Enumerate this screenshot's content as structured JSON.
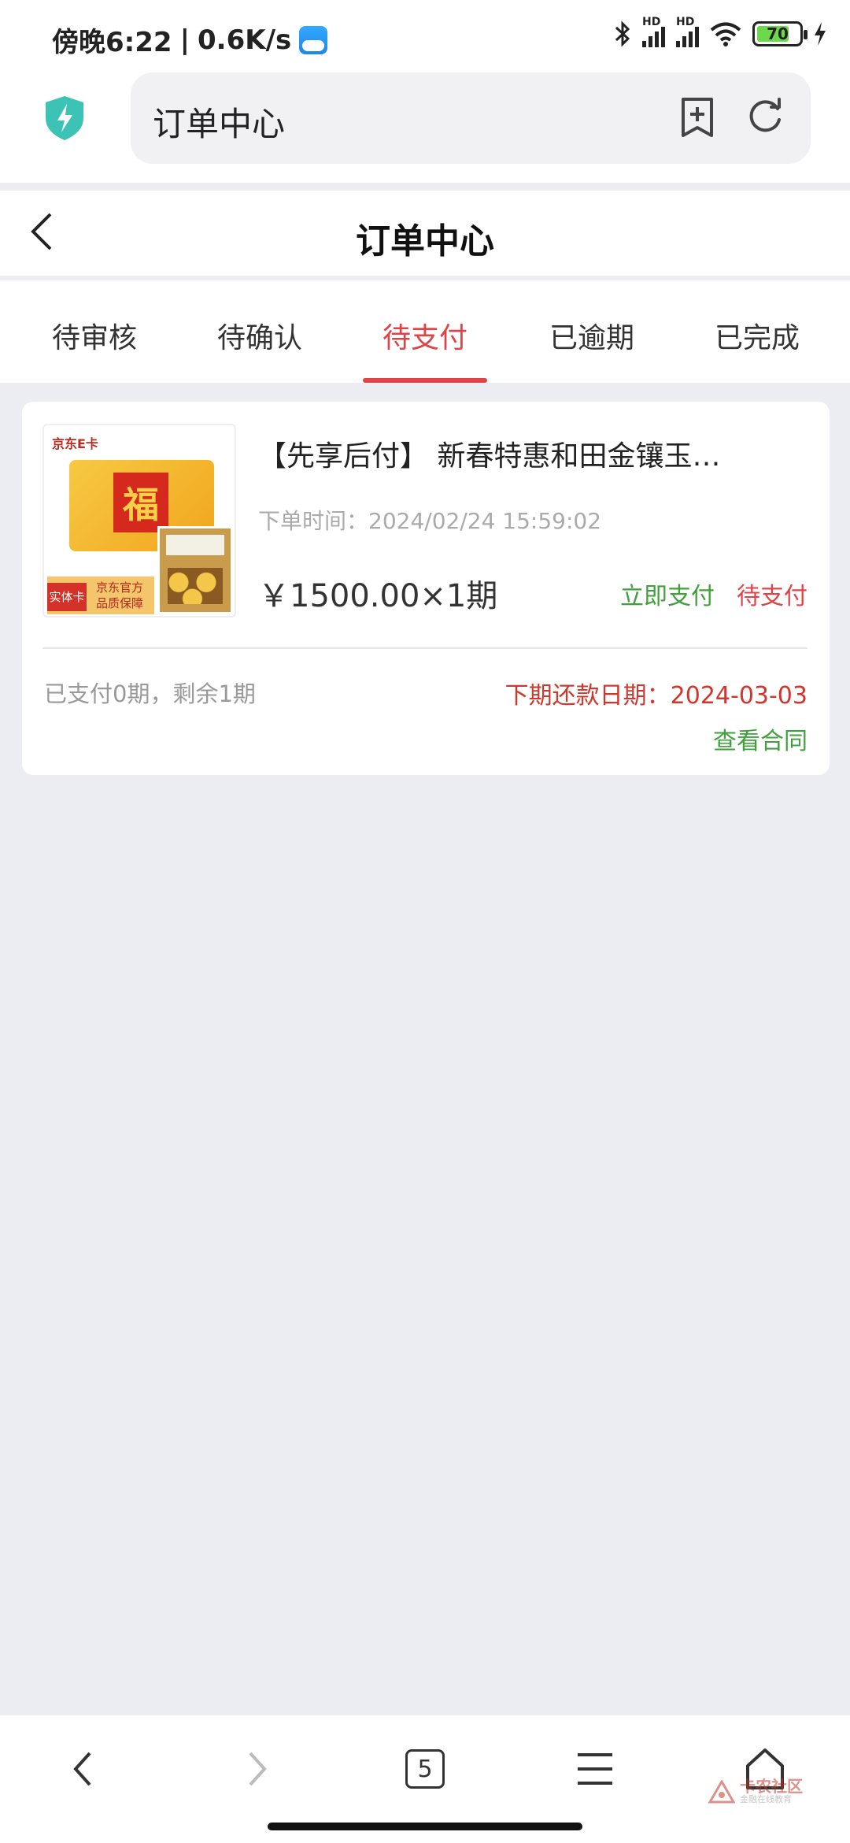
{
  "status_bar": {
    "time": "傍晚6:22",
    "speed": "0.6K/s",
    "network1": "HD",
    "network2": "HD",
    "battery": "70"
  },
  "browser": {
    "address_title": "订单中心",
    "tab_count": "5"
  },
  "header": {
    "title": "订单中心"
  },
  "tabs": [
    {
      "label": "待审核"
    },
    {
      "label": "待确认"
    },
    {
      "label": "待支付"
    },
    {
      "label": "已逾期"
    },
    {
      "label": "已完成"
    }
  ],
  "active_tab": "待支付",
  "order": {
    "thumb_logo": "京东E卡",
    "thumb_badge": "实体卡",
    "thumb_slogan_1": "京东官方",
    "thumb_slogan_2": "品质保障",
    "thumb_fu": "福",
    "product_name": "【先享后付】 新春特惠和田金镶玉…",
    "order_time": "下单时间：2024/02/24 15:59:02",
    "price": "￥1500.00×1期",
    "pay_button": "立即支付",
    "status": "待支付",
    "paid_info": "已支付0期，剩余1期",
    "next_due": "下期还款日期：2024-03-03",
    "contract_link": "查看合同"
  },
  "watermark": {
    "title": "卡农社区",
    "subtitle": "金融在线教育"
  },
  "colors": {
    "accent_red": "#e04347",
    "accent_green": "#3fa13a",
    "background": "#ecedf3"
  }
}
